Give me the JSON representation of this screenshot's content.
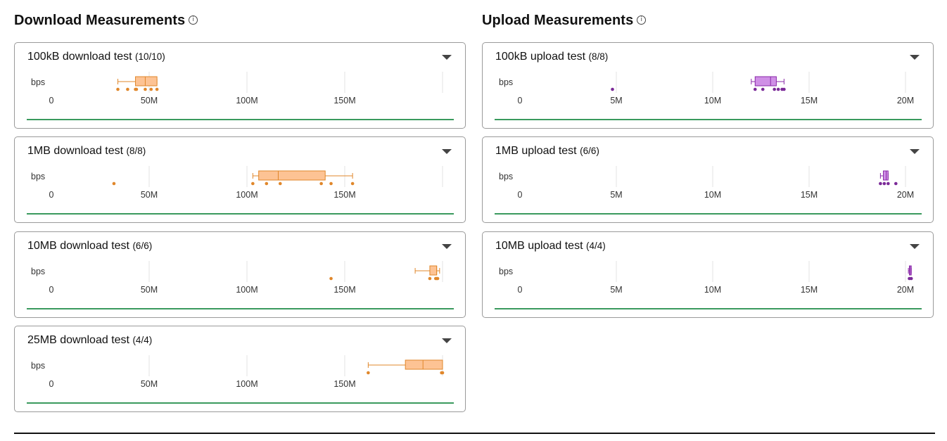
{
  "download": {
    "title": "Download Measurements",
    "info_icon": "info-icon",
    "tests": [
      {
        "id": "dl-100kb",
        "label": "100kB download test",
        "count": "(10/10)"
      },
      {
        "id": "dl-1mb",
        "label": "1MB download test",
        "count": "(8/8)"
      },
      {
        "id": "dl-10mb",
        "label": "10MB download test",
        "count": "(6/6)"
      },
      {
        "id": "dl-25mb",
        "label": "25MB download test",
        "count": "(4/4)"
      }
    ]
  },
  "upload": {
    "title": "Upload Measurements",
    "info_icon": "info-icon",
    "tests": [
      {
        "id": "ul-100kb",
        "label": "100kB upload test",
        "count": "(8/8)"
      },
      {
        "id": "ul-1mb",
        "label": "1MB upload test",
        "count": "(6/6)"
      },
      {
        "id": "ul-10mb",
        "label": "10MB upload test",
        "count": "(4/4)"
      }
    ]
  },
  "colors": {
    "download_box_fill": "#fdc394",
    "download_box_stroke": "#e0872b",
    "download_points": "#e0872b",
    "upload_box_fill": "#cf8fe6",
    "upload_box_stroke": "#8a2aa8",
    "upload_points": "#7b2a98",
    "baseline": "#3a9a5e",
    "gridline": "#e3e3e3",
    "border": "#9a9a9a"
  },
  "chart_data": [
    {
      "type": "box",
      "title": "100kB download test",
      "ylabel": "bps",
      "xticks": [
        "0",
        "50M",
        "100M",
        "150M"
      ],
      "xlim": [
        0,
        200000000
      ],
      "box": {
        "whisker_low": 34000000,
        "q1": 43000000,
        "median": 48000000,
        "q3": 54000000,
        "whisker_high": 54000000
      },
      "points": [
        34000000,
        39000000,
        43000000,
        43500000,
        48000000,
        51000000,
        54000000
      ]
    },
    {
      "type": "box",
      "title": "1MB download test",
      "ylabel": "bps",
      "xticks": [
        "0",
        "50M",
        "100M",
        "150M"
      ],
      "xlim": [
        0,
        200000000
      ],
      "box": {
        "whisker_low": 103000000,
        "q1": 106000000,
        "median": 116000000,
        "q3": 140000000,
        "whisker_high": 154000000
      },
      "points": [
        32000000,
        103000000,
        110000000,
        117000000,
        138000000,
        143000000,
        154000000
      ]
    },
    {
      "type": "box",
      "title": "10MB download test",
      "ylabel": "bps",
      "xticks": [
        "0",
        "50M",
        "100M",
        "150M"
      ],
      "xlim": [
        0,
        200000000
      ],
      "box": {
        "whisker_low": 186000000,
        "q1": 193500000,
        "median": 197000000,
        "q3": 197000000,
        "whisker_high": 198500000
      },
      "points": [
        143000000,
        193500000,
        196500000,
        197000000,
        197500000
      ]
    },
    {
      "type": "box",
      "title": "25MB download test",
      "ylabel": "bps",
      "xticks": [
        "0",
        "50M",
        "100M",
        "150M"
      ],
      "xlim": [
        0,
        200000000
      ],
      "box": {
        "whisker_low": 162000000,
        "q1": 181000000,
        "median": 190000000,
        "q3": 200000000,
        "whisker_high": 200000000
      },
      "points": [
        162000000,
        199500000,
        200000000
      ]
    },
    {
      "type": "box",
      "title": "100kB upload test",
      "ylabel": "bps",
      "xticks": [
        "0",
        "5M",
        "10M",
        "15M",
        "20M"
      ],
      "xlim": [
        0,
        21000000
      ],
      "box": {
        "whisker_low": 12000000,
        "q1": 12200000,
        "median": 13000000,
        "q3": 13300000,
        "whisker_high": 13700000
      },
      "points": [
        4800000,
        12200000,
        12600000,
        13200000,
        13400000,
        13600000,
        13700000
      ]
    },
    {
      "type": "box",
      "title": "1MB upload test",
      "ylabel": "bps",
      "xticks": [
        "0",
        "5M",
        "10M",
        "15M",
        "20M"
      ],
      "xlim": [
        0,
        21000000
      ],
      "box": {
        "whisker_low": 18700000,
        "q1": 18850000,
        "median": 19000000,
        "q3": 19100000,
        "whisker_high": 19100000
      },
      "points": [
        18700000,
        18900000,
        19100000,
        19500000
      ]
    },
    {
      "type": "box",
      "title": "10MB upload test",
      "ylabel": "bps",
      "xticks": [
        "0",
        "5M",
        "10M",
        "15M",
        "20M"
      ],
      "xlim": [
        0,
        21000000
      ],
      "box": {
        "whisker_low": 20150000,
        "q1": 20200000,
        "median": 20250000,
        "q3": 20300000,
        "whisker_high": 20300000
      },
      "points": [
        20200000,
        20300000
      ]
    }
  ]
}
